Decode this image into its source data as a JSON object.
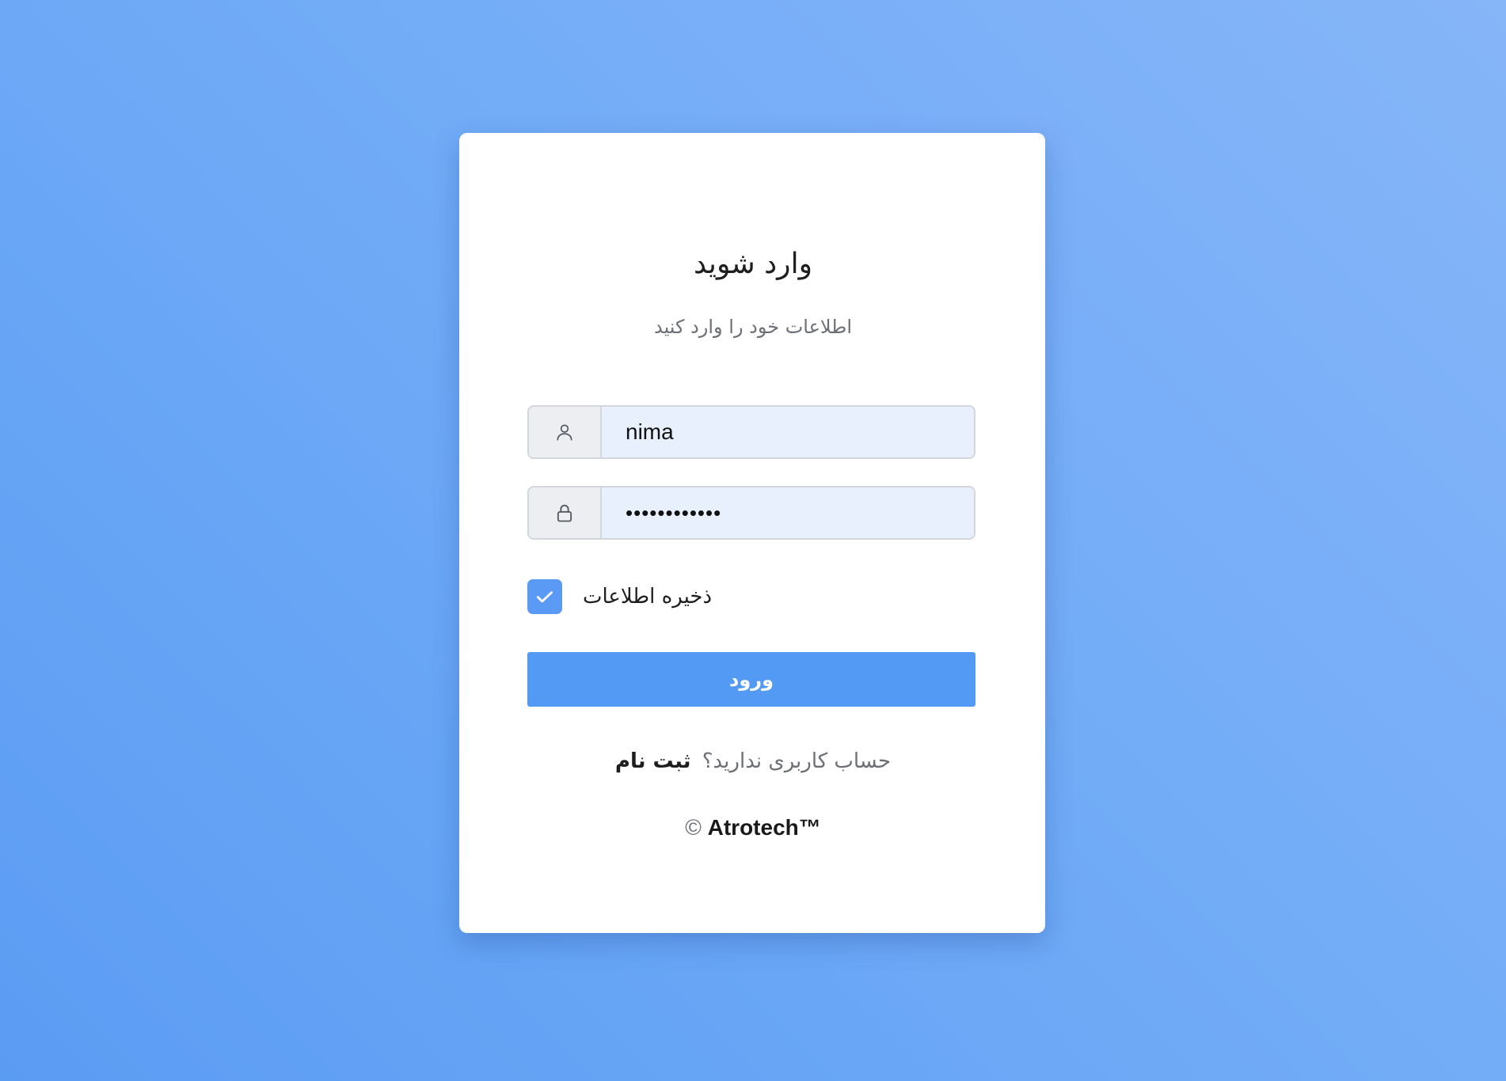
{
  "login": {
    "title": "وارد شوید",
    "subtitle": "اطلاعات خود را وارد کنید",
    "username": {
      "value": "nima",
      "icon": "user-icon"
    },
    "password": {
      "value": "••••••••••••",
      "icon": "lock-icon"
    },
    "remember": {
      "label": "ذخیره اطلاعات",
      "checked": true
    },
    "submit_label": "ورود",
    "signup_prompt": "حساب کاربری ندارید؟",
    "signup_link": "ثبت نام",
    "copyright_symbol": "©",
    "brand": "Atrotech™"
  },
  "colors": {
    "background": "#6aa5f5",
    "accent": "#529af4",
    "card": "#ffffff",
    "input_fill": "#e8f0fe"
  }
}
